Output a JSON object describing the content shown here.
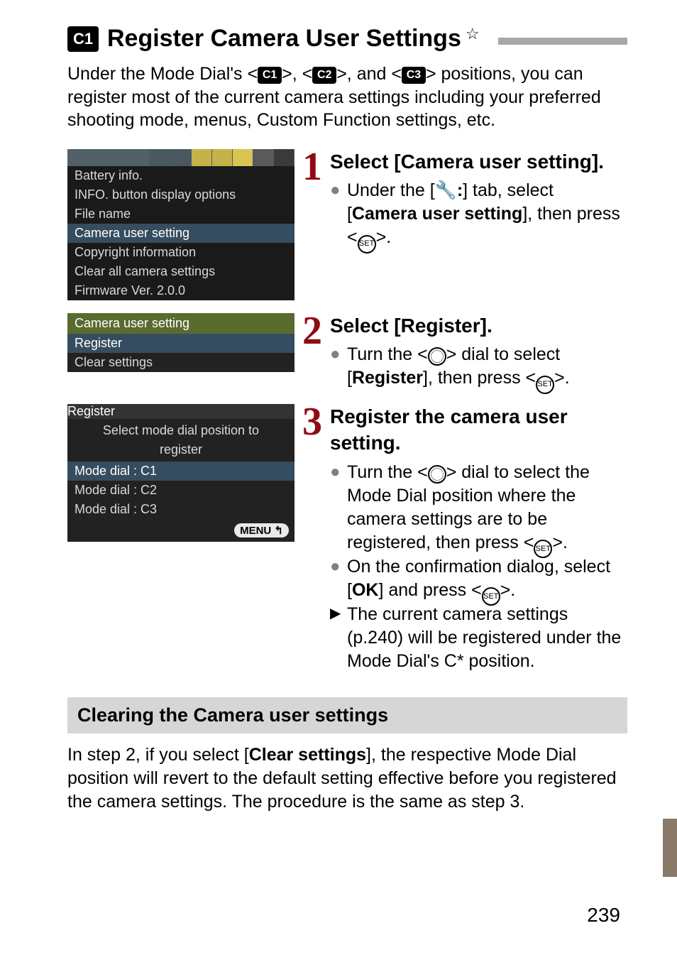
{
  "title": {
    "icon_label": "C1",
    "text": "Register Camera User Settings",
    "star": "☆"
  },
  "intro": {
    "pre": "Under the Mode Dial's <",
    "c1": "C1",
    "mid1": ">, <",
    "c2": "C2",
    "mid2": ">, and <",
    "c3": "C3",
    "post": "> positions, you can register most of the current camera settings including your preferred shooting mode, menus, Custom Function settings, etc."
  },
  "lcd1": {
    "items": [
      "Battery info.",
      "INFO. button display options",
      "File name",
      "Camera user setting",
      "Copyright information",
      "Clear all camera settings",
      "Firmware Ver. 2.0.0"
    ],
    "highlight_index": 3
  },
  "lcd2": {
    "header": "Camera user setting",
    "items": [
      "Register",
      "Clear settings"
    ],
    "highlight_index": 0
  },
  "lcd3": {
    "header": "Register",
    "prompt_line1": "Select mode dial position to",
    "prompt_line2": "register",
    "items": [
      "Mode dial : C1",
      "Mode dial : C2",
      "Mode dial : C3"
    ],
    "highlight_index": 0,
    "menu_label": "MENU ↰"
  },
  "steps": {
    "s1": {
      "num": "1",
      "head": "Select [Camera user setting].",
      "b1_pre": "Under the [",
      "b1_icon": "🔧:",
      "b1_mid": "] tab, select [",
      "b1_bold": "Camera user setting",
      "b1_post": "], then press <",
      "b1_set": "SET",
      "b1_end": ">."
    },
    "s2": {
      "num": "2",
      "head": "Select [Register].",
      "b1_pre": "Turn the <",
      "b1_post": "> dial to select [",
      "b1_bold": "Register",
      "b1_mid2": "], then press <",
      "b1_set": "SET",
      "b1_end": ">."
    },
    "s3": {
      "num": "3",
      "head": "Register the camera user setting.",
      "b1_pre": "Turn the <",
      "b1_post": "> dial to select the Mode Dial position where the camera settings are to be registered, then press <",
      "b1_set": "SET",
      "b1_end": ">.",
      "b2_pre": "On the confirmation dialog, select [",
      "b2_bold": "OK",
      "b2_mid": "] and press <",
      "b2_set": "SET",
      "b2_end": ">.",
      "b3": "The current camera settings (p.240) will be registered under the Mode Dial's C* position."
    }
  },
  "clearing": {
    "head": "Clearing the Camera user settings",
    "body_pre": "In step 2, if you select [",
    "body_bold": "Clear settings",
    "body_post": "], the respective Mode Dial position will revert to the default setting effective before you registered the camera settings. The procedure is the same as step 3."
  },
  "page_number": "239"
}
